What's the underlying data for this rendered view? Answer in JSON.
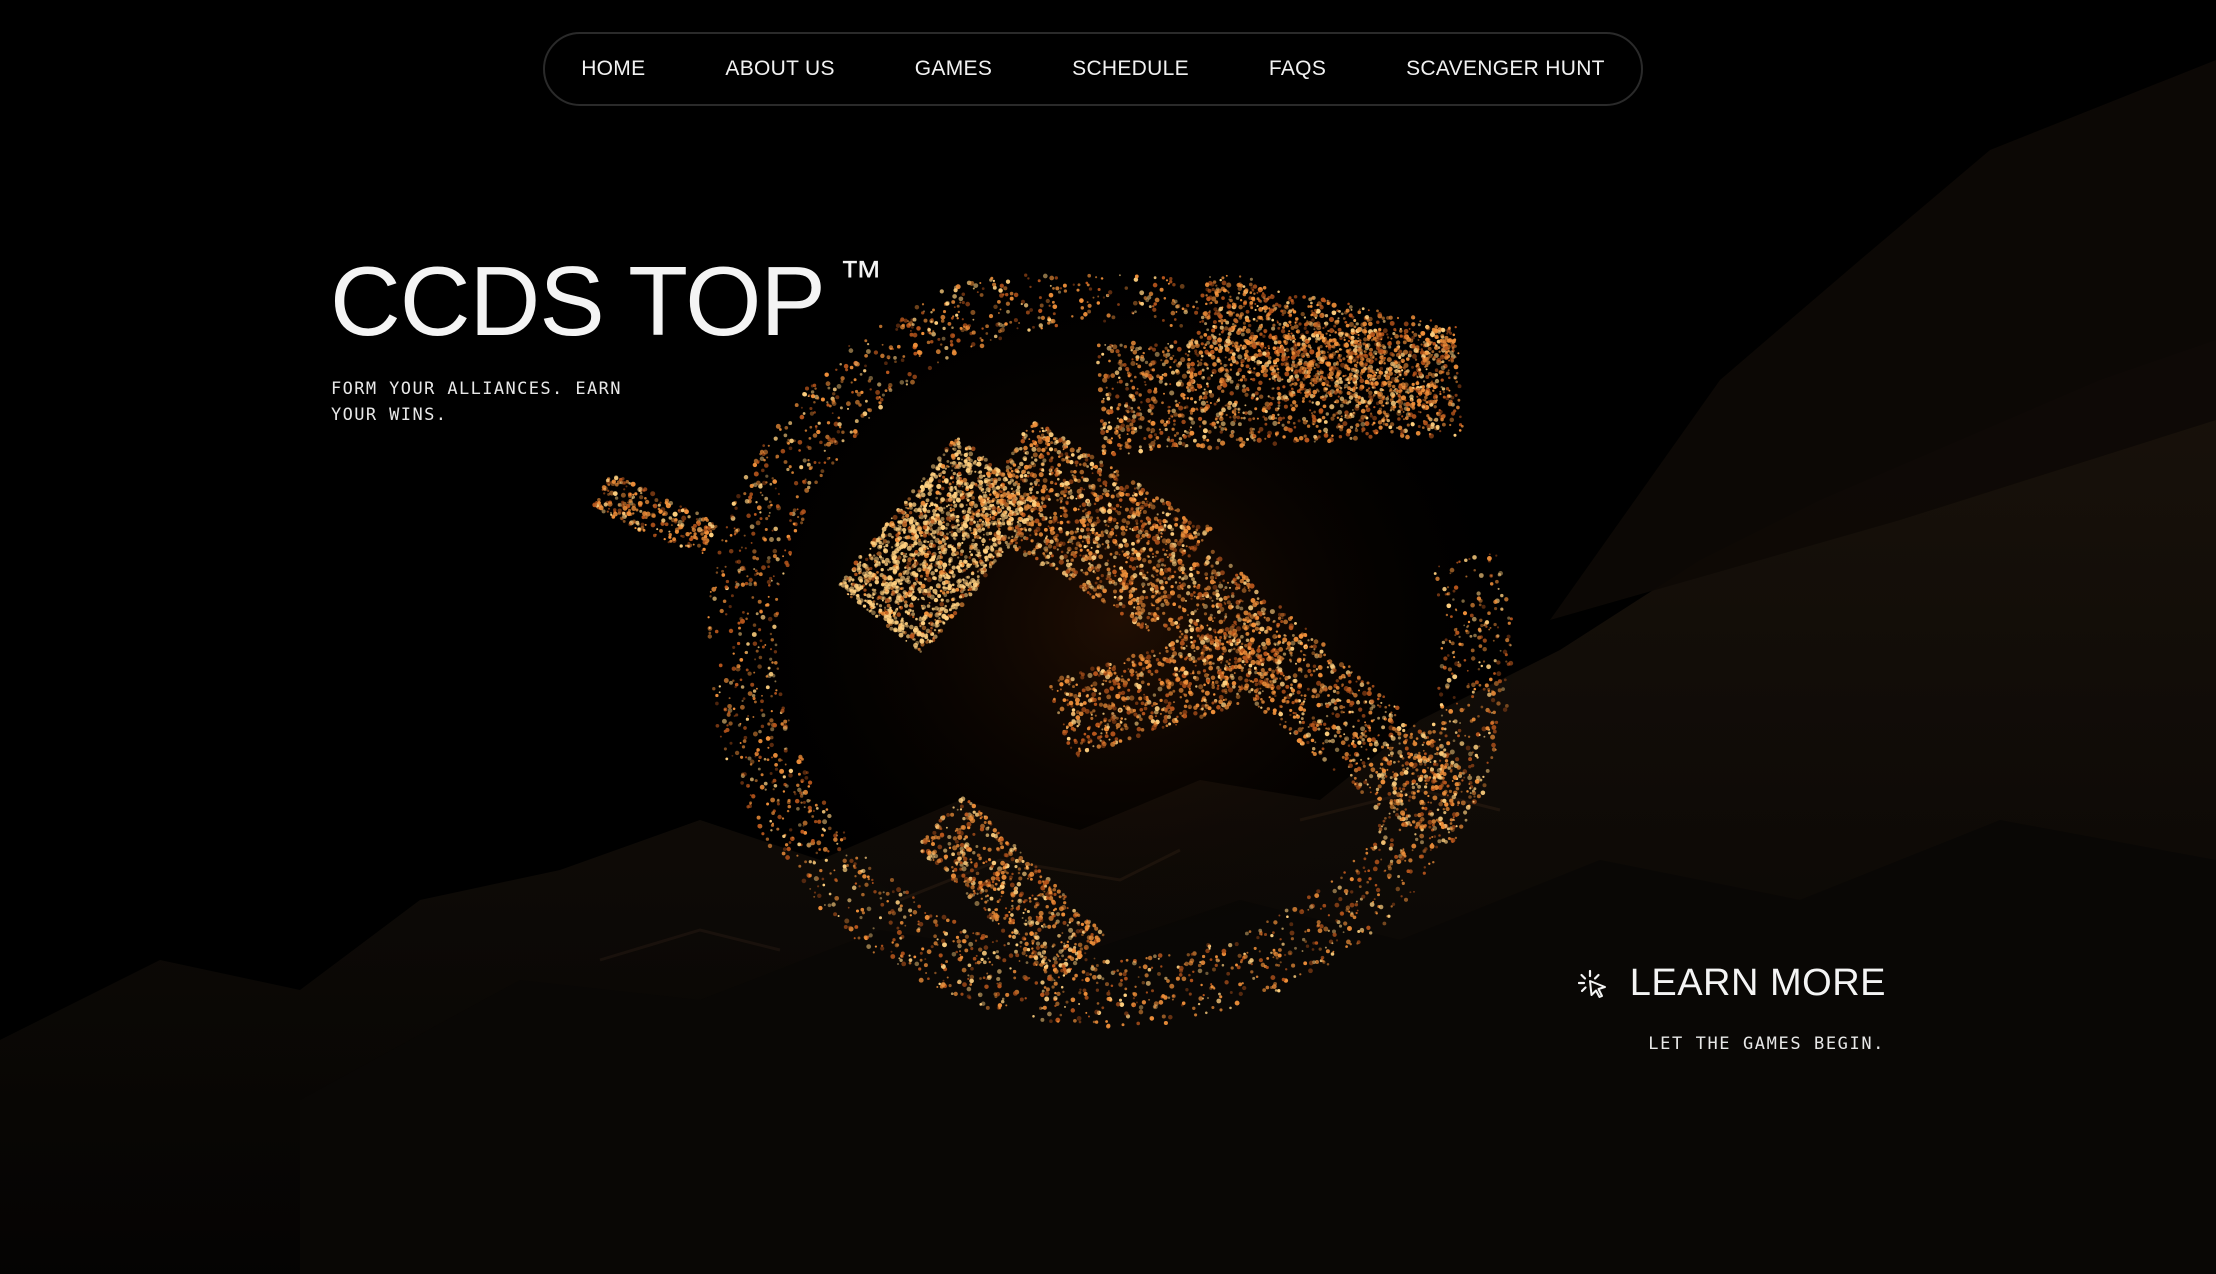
{
  "nav": {
    "items": [
      {
        "label": "HOME"
      },
      {
        "label": "ABOUT US"
      },
      {
        "label": "GAMES"
      },
      {
        "label": "SCHEDULE"
      },
      {
        "label": "FAQS"
      },
      {
        "label": "SCAVENGER HUNT"
      }
    ]
  },
  "hero": {
    "title": "CCDS TOP",
    "trademark": "™",
    "subtitle": "FORM YOUR ALLIANCES. EARN YOUR WINS."
  },
  "cta": {
    "label": "LEARN MORE",
    "subtitle": "LET THE GAMES BEGIN.",
    "icon": "cursor-click-icon"
  },
  "colors": {
    "background": "#000000",
    "particle_bright": "#ffd080",
    "particle_mid": "#f0903a",
    "particle_dim": "#b8561c",
    "text": "#f4f4f4"
  }
}
